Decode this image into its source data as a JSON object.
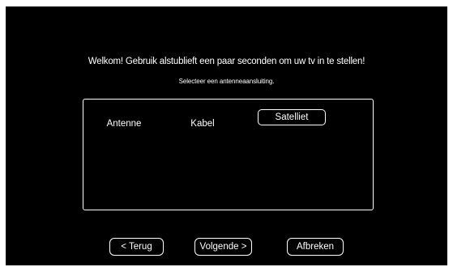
{
  "setup": {
    "welcome_text": "Welkom! Gebruik alstublieft een paar seconden om uw tv in te stellen!",
    "instruction_text": "Selecteer een antenneaansluiting."
  },
  "antenna_options": [
    {
      "label": "Antenne"
    },
    {
      "label": "Kabel"
    },
    {
      "label": "Satelliet",
      "selected": true
    }
  ],
  "buttons": {
    "back_label": "< Terug",
    "next_label": "Volgende >",
    "cancel_label": "Afbreken"
  },
  "colors": {
    "background": "#000000",
    "foreground": "#ffffff"
  }
}
